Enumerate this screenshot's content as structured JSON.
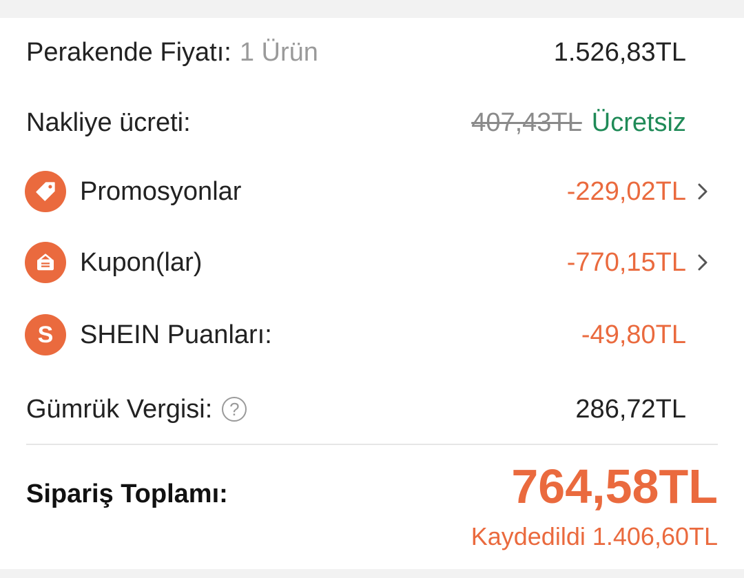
{
  "summary": {
    "retail": {
      "label": "Perakende Fiyatı:",
      "count": "1 Ürün",
      "value": "1.526,83TL"
    },
    "shipping": {
      "label": "Nakliye ücreti:",
      "original": "407,43TL",
      "value": "Ücretsiz"
    },
    "promotions": {
      "label": "Promosyonlar",
      "value": "-229,02TL",
      "icon": "tag-icon"
    },
    "coupons": {
      "label": "Kupon(lar)",
      "value": "-770,15TL",
      "icon": "coupon-icon"
    },
    "points": {
      "label": "SHEIN Puanları:",
      "value": "-49,80TL",
      "icon_letter": "S"
    },
    "customs": {
      "label": "Gümrük Vergisi:",
      "value": "286,72TL",
      "help_symbol": "?"
    },
    "total": {
      "label": "Sipariş Toplamı:",
      "value": "764,58TL",
      "saved": "Kaydedildi 1.406,60TL"
    }
  },
  "colors": {
    "accent": "#ea6a3e",
    "free": "#1f8a57",
    "muted": "#9a9a9a"
  }
}
